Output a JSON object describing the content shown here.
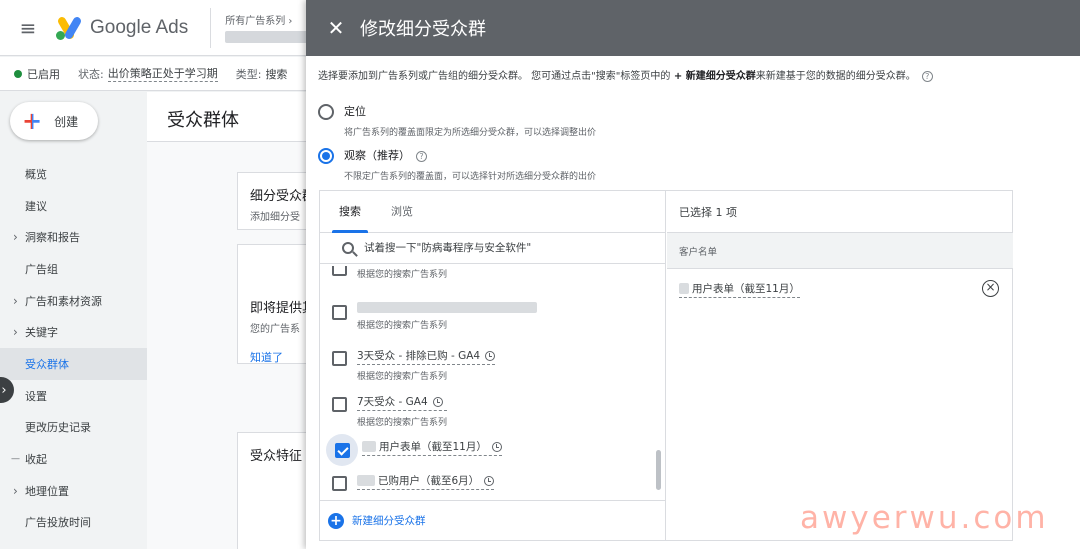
{
  "app": {
    "product_name": "Google Ads",
    "breadcrumb_top": "所有广告系列 ›"
  },
  "status_bar": {
    "status": "已启用",
    "state_label": "状态:",
    "state_value": "出价策略正处于学习期",
    "type_label": "类型:",
    "type_value": "搜索"
  },
  "sidebar": {
    "create_label": "创建",
    "items": [
      {
        "label": "概览"
      },
      {
        "label": "建议"
      },
      {
        "label": "洞察和报告"
      },
      {
        "label": "广告组"
      },
      {
        "label": "广告和素材资源"
      },
      {
        "label": "关键字"
      },
      {
        "label": "受众群体"
      },
      {
        "label": "设置"
      },
      {
        "label": "更改历史记录"
      },
      {
        "label": "收起"
      },
      {
        "label": "地理位置"
      },
      {
        "label": "广告投放时间"
      }
    ]
  },
  "content": {
    "title": "受众群体",
    "card1_title": "细分受众群",
    "card1_sub": "添加细分受",
    "card2_title": "即将提供其",
    "card2_sub": "您的广告系",
    "card2_link": "知道了",
    "card3_title": "受众特征"
  },
  "panel": {
    "title": "修改细分受众群",
    "intro_pre": "选择要添加到广告系列或广告组的细分受众群。 您可通过点击\"搜索\"标签页中的",
    "intro_bold": " + 新建细分受众群",
    "intro_post": "来新建基于您的数据的细分受众群。",
    "targeting": {
      "label": "定位",
      "desc": "将广告系列的覆盖面限定为所选细分受众群，可以选择调整出价"
    },
    "observation": {
      "label": "观察（推荐）",
      "desc": "不限定广告系列的覆盖面，可以选择针对所选细分受众群的出价"
    },
    "tabs": [
      "搜索",
      "浏览"
    ],
    "search_placeholder": "试着搜一下\"防病毒程序与安全软件\"",
    "list_items": [
      {
        "name": "",
        "sub": "根据您的搜索广告系列",
        "checked": false
      },
      {
        "name": "",
        "sub": "根据您的搜索广告系列",
        "checked": false
      },
      {
        "name": "3天受众 - 排除已购 - GA4",
        "sub": "根据您的搜索广告系列",
        "checked": false
      },
      {
        "name": "7天受众 - GA4",
        "sub": "根据您的搜索广告系列",
        "checked": false
      },
      {
        "name": "用户表单（截至11月）",
        "sub": "",
        "checked": true
      },
      {
        "name": "已购用户（截至6月）",
        "sub": "",
        "checked": false
      }
    ],
    "add_new_label": "新建细分受众群",
    "selected_header": "已选择 1 项",
    "group_header": "客户名单",
    "selected_item": "用户表单（截至11月）"
  },
  "watermark": "awyerwu.com",
  "colors": {
    "accent": "#1a73e8",
    "header_bg": "#5f6368",
    "status_green": "#1e8e3e"
  }
}
